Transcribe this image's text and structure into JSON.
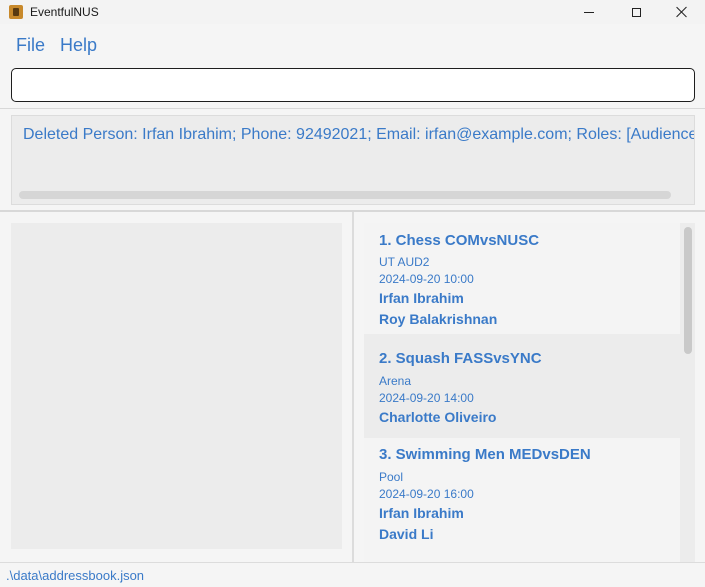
{
  "window": {
    "title": "EventfulNUS",
    "accent_color": "#3a7ac8",
    "controls": [
      "minimize-icon",
      "maximize-icon",
      "close-icon"
    ]
  },
  "menu": {
    "file": "File",
    "help": "Help"
  },
  "command": {
    "value": "",
    "placeholder": ""
  },
  "result": {
    "text": "Deleted Person: Irfan Ibrahim; Phone: 92492021; Email: irfan@example.com; Roles: [Audience]"
  },
  "events": [
    {
      "title": "1. Chess COMvsNUSC",
      "venue": "UT AUD2",
      "datetime": "2024-09-20 10:00",
      "people": [
        "Irfan Ibrahim",
        "Roy Balakrishnan"
      ]
    },
    {
      "title": "2. Squash FASSvsYNC",
      "venue": "Arena",
      "datetime": "2024-09-20 14:00",
      "people": [
        "Charlotte Oliveiro"
      ]
    },
    {
      "title": "3. Swimming Men MEDvsDEN",
      "venue": "Pool",
      "datetime": "2024-09-20 16:00",
      "people": [
        "Irfan Ibrahim",
        "David Li"
      ]
    }
  ],
  "status": {
    "path": ".\\data\\addressbook.json"
  }
}
